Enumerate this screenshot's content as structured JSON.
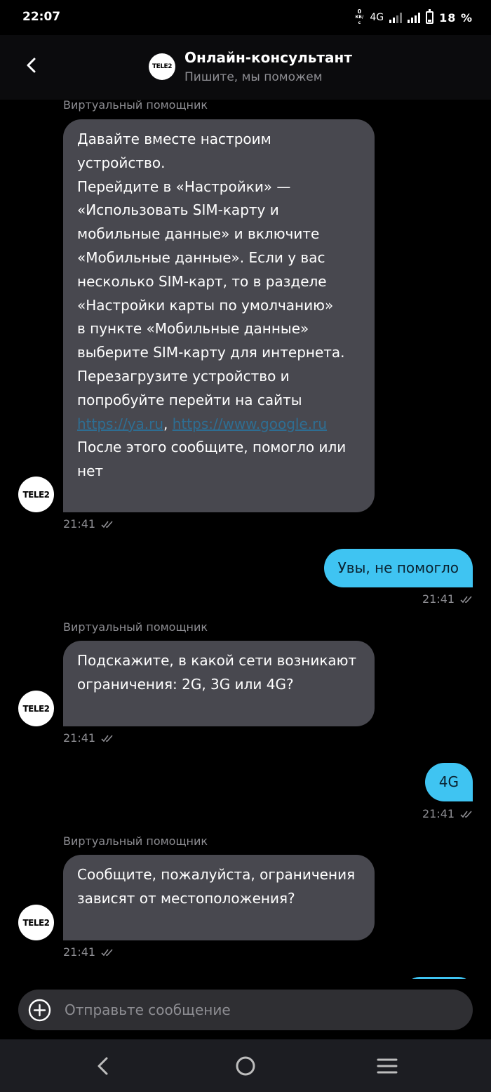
{
  "status_bar": {
    "time": "22:07",
    "speed_value": "0",
    "speed_unit": "КБ/с",
    "network": "4G",
    "battery": "18 %"
  },
  "header": {
    "logo_text": "TELE2",
    "title": "Онлайн-консультант",
    "subtitle": "Пишите, мы поможем"
  },
  "messages": [
    {
      "sender": "Виртуальный помощник",
      "text_before_links": "Давайте вместе настроим\nустройство.\nПерейдите в «Настройки» —\n«Использовать SIM-карту и\nмобильные данные» и включите\n«Мобильные данные». Если у вас\nнесколько SIM-карт, то в разделе\n«Настройки карты по умолчанию»\nв пункте «Мобильные данные»\nвыберите SIM-карту для интернета.\nПерезагрузите устройство и\nпопробуйте перейти на сайты\n",
      "link1": "https://ya.ru",
      "link_sep": ", ",
      "link2": "https://www.google.ru",
      "text_after_links": "\nПосле этого сообщите, помогло или\nнет",
      "time": "21:41",
      "avatar_text": "TELE2"
    },
    {
      "text": "Увы, не помогло",
      "time": "21:41"
    },
    {
      "sender": "Виртуальный помощник",
      "text": "Подскажите, в какой сети возникают\nограничения: 2G, 3G или 4G?",
      "time": "21:41",
      "avatar_text": "TELE2"
    },
    {
      "text": "4G",
      "time": "21:41"
    },
    {
      "sender": "Виртуальный помощник",
      "text": "Сообщите, пожалуйста, ограничения\nзависят от местоположения?",
      "time": "21:41",
      "avatar_text": "TELE2"
    }
  ],
  "composer": {
    "placeholder": "Отправьте сообщение"
  },
  "colors": {
    "bot_bubble": "#48484f",
    "user_bubble": "#3fc4f2",
    "background": "#000000",
    "muted_text": "#8e8e93"
  }
}
